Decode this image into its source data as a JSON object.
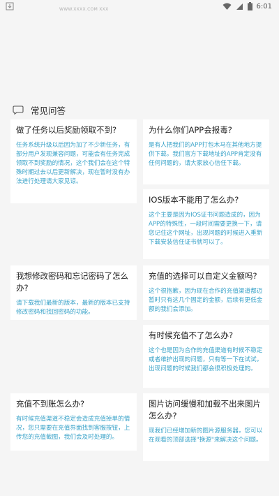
{
  "status_bar": {
    "time": "6:01",
    "icons": [
      "notification-download-icon",
      "wifi-icon",
      "signal-icon",
      "battery-icon"
    ]
  },
  "faint_url": "WWW.XXXX.COM XXX",
  "section": {
    "title": "常见问答"
  },
  "cards": [
    {
      "q": "做了任务以后奖励领取不到?",
      "a": "任务系统升级以后因为加了不少新任务，有部分用户发现兼容问题，可能会有任务完成领取不到奖励的情况，这个我们会在这个特殊时期过去以后更新解决，现在暂时没有办法进行处理请大家见谅。"
    },
    {
      "q": "为什么你们APP会报毒?",
      "a": "是有人把我们的APP打包木马在其他地方提供下载，我们官方下载地址的APP肯定没有任何问题的，请大家放心信任下载。"
    },
    {
      "q": "IOS版本不能用了怎么办?",
      "a": "这个主要是因为IOS证书问题造成的，因为APP的特殊性，一段时间需要更换一下，请您记住这个网址，出现问题的时候进入重新下载安装信任证书就可以了。"
    },
    {
      "q": "我想修改密码和忘记密码了怎么办?",
      "a": "请下载我们最新的版本，最新的版本已支持修改密码和找回密码的功能。"
    },
    {
      "q": "充值的选择可以自定义金额吗?",
      "a": "这个很抱歉，因为现在合作的充值渠道都迈暂时只有这几个固定的金额，后续有更低金额的我们会添加。"
    },
    {
      "q": "有时候充值不了怎么办?",
      "a": "这个也是因为合作的充值渠道有时候不稳定或者维护出现的问题，只有等一下在试试，出现问题的时候我们都会很积极处理的。"
    },
    {
      "q": "充值不到账怎么办?",
      "a": "有时候充值渠道不稳定会造成充值掉单的情况，您只需要在充值界面找到客服按钮，上传您的充值截图，我们会及时处理的。"
    },
    {
      "q": "图片访问缓慢和加载不出来图片怎么办?",
      "a": "现我们已经增加新的图片源服务器，您可以在观看的顶部选择\"换源\"来解决这个问题。"
    }
  ]
}
